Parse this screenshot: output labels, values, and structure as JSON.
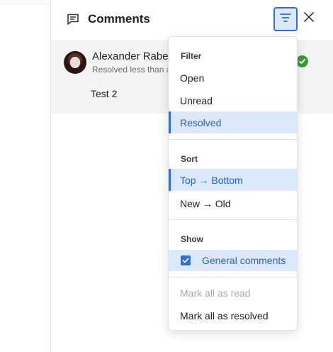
{
  "header": {
    "title": "Comments",
    "icons": [
      "comment-icon",
      "filter-icon",
      "close-icon"
    ]
  },
  "comment": {
    "author": "Alexander Raber",
    "status": "Resolved less than a minute ago",
    "text": "Test 2",
    "status_icon": "check-circle-icon"
  },
  "menu": {
    "filter_heading": "Filter",
    "filter_items": [
      "Open",
      "Unread",
      "Resolved"
    ],
    "filter_selected": "Resolved",
    "sort_heading": "Sort",
    "sort_items": [
      "Top → Bottom",
      "New → Old"
    ],
    "sort_selected": "Top → Bottom",
    "show_heading": "Show",
    "show_general_comments": "General comments",
    "show_general_comments_checked": true,
    "mark_all_read": "Mark all as read",
    "mark_all_read_disabled": true,
    "mark_all_resolved": "Mark all as resolved"
  },
  "colors": {
    "accent": "#2f6fd6",
    "selected_bg": "#dde9fb",
    "resolved_green": "#3e9a3a",
    "card_bg": "#f4f4f4"
  }
}
